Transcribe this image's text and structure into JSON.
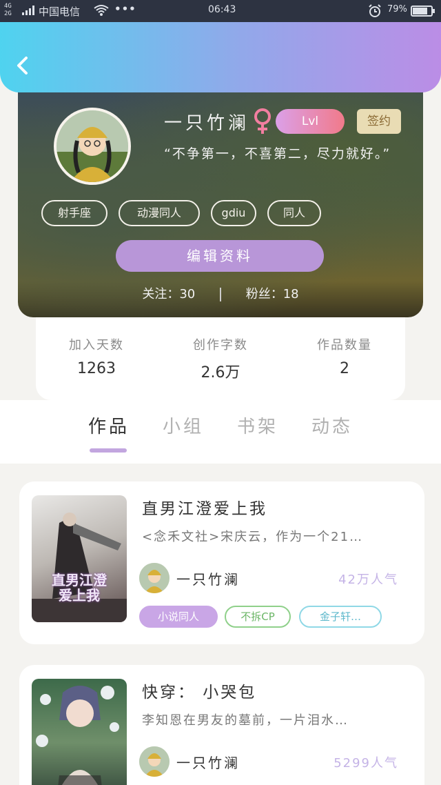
{
  "status_bar": {
    "network": "4G\n2G",
    "carrier": "中国电信",
    "more": "•••",
    "time": "06:43",
    "battery": "79%"
  },
  "profile": {
    "username": "一只竹澜",
    "level": "Lvl",
    "contract": "签约",
    "motto": "“不争第一，不喜第二，尽力就好。”",
    "tags": [
      "射手座",
      "动漫同人",
      "gdiu",
      "同人"
    ],
    "edit_label": "编辑资料",
    "following_label": "关注：",
    "following": "30",
    "fans_label": "粉丝：",
    "fans": "18"
  },
  "stats": [
    {
      "label": "加入天数",
      "value": "1263"
    },
    {
      "label": "创作字数",
      "value": "2.6万"
    },
    {
      "label": "作品数量",
      "value": "2"
    }
  ],
  "tabs": [
    "作品",
    "小组",
    "书架",
    "动态"
  ],
  "works": [
    {
      "title": "直男江澄爱上我",
      "desc": "<念禾文社>宋庆云，作为一个21…",
      "author": "一只竹澜",
      "popularity": "42万人气",
      "tags": [
        "小说同人",
        "不拆CP",
        "金子轩…"
      ],
      "cover_text": "直男江澄\n爱上我"
    },
    {
      "title": "快穿： 小哭包",
      "desc": "李知恩在男友的墓前，一片泪水…",
      "author": "一只竹澜",
      "popularity": "5299人气"
    }
  ],
  "colors": {
    "accent": "#b896d8",
    "header_start": "#4fd3ef",
    "header_end": "#bb8de6",
    "tag_purple": "#c9a6e6",
    "tag_green": "#8fd08a",
    "tag_blue": "#8fd8e6"
  }
}
